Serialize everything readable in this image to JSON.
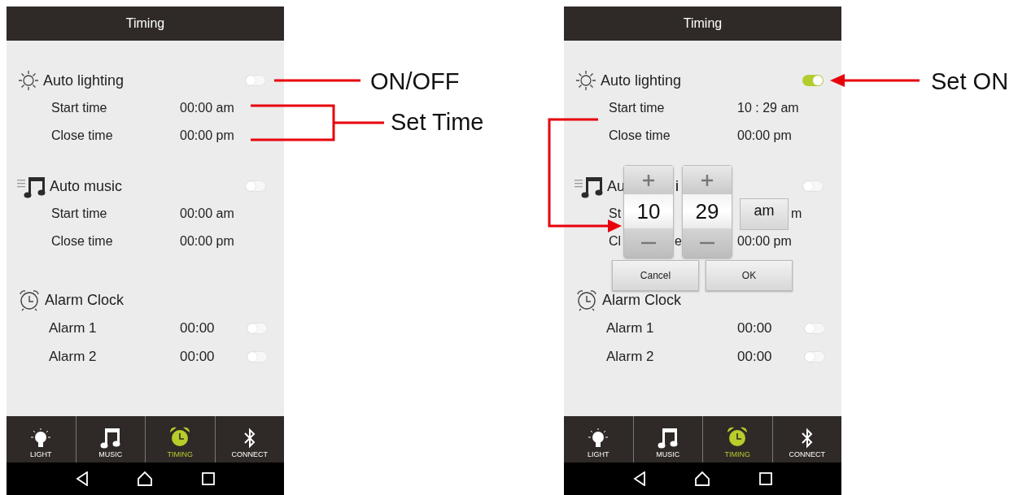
{
  "phones": [
    {
      "title": "Timing",
      "sections": [
        {
          "kind": "lighting",
          "title": "Auto lighting",
          "on": false,
          "rows": [
            {
              "kind": "time",
              "label": "Start time",
              "value": "00:00 am"
            },
            {
              "kind": "time",
              "label": "Close time",
              "value": "00:00 pm"
            }
          ]
        },
        {
          "kind": "music",
          "title": "Auto music",
          "on": false,
          "rows": [
            {
              "kind": "time",
              "label": "Start time",
              "value": "00:00 am"
            },
            {
              "kind": "time",
              "label": "Close time",
              "value": "00:00 pm"
            }
          ]
        },
        {
          "kind": "alarm",
          "title": "Alarm Clock",
          "rows": [
            {
              "kind": "alarm",
              "label": "Alarm 1",
              "value": "00:00",
              "on": false
            },
            {
              "kind": "alarm",
              "label": "Alarm 2",
              "value": "00:00",
              "on": false
            }
          ]
        }
      ],
      "tabs": [
        {
          "kind": "light",
          "label": "LIGHT",
          "selected": false
        },
        {
          "kind": "music",
          "label": "MUSIC",
          "selected": false
        },
        {
          "kind": "timing",
          "label": "TIMING",
          "selected": true
        },
        {
          "kind": "connect",
          "label": "CONNECT",
          "selected": false
        }
      ]
    },
    {
      "title": "Timing",
      "sections": [
        {
          "kind": "lighting",
          "title": "Auto lighting",
          "on": true,
          "rows": [
            {
              "kind": "time",
              "label": "Start time",
              "value": "10 : 29 am"
            },
            {
              "kind": "time",
              "label": "Close time",
              "value": "00:00 pm"
            }
          ]
        },
        {
          "kind": "music",
          "title": "Au",
          "title_tail": "i",
          "on": false,
          "rows": [
            {
              "kind": "time",
              "label": "St",
              "value_tail": "m"
            },
            {
              "kind": "time",
              "label": "Cl",
              "label_tail": "e",
              "value": "00:00 pm"
            }
          ]
        },
        {
          "kind": "alarm",
          "title": "Alarm Clock",
          "rows": [
            {
              "kind": "alarm",
              "label": "Alarm 1",
              "value": "00:00",
              "on": false
            },
            {
              "kind": "alarm",
              "label": "Alarm 2",
              "value": "00:00",
              "on": false
            }
          ]
        }
      ],
      "dialog": {
        "hours": "10",
        "minutes": "29",
        "period": "am",
        "buttons": [
          "Cancel",
          "OK"
        ]
      },
      "tabs": [
        {
          "kind": "light",
          "label": "LIGHT",
          "selected": false
        },
        {
          "kind": "music",
          "label": "MUSIC",
          "selected": false
        },
        {
          "kind": "timing",
          "label": "TIMING",
          "selected": true
        },
        {
          "kind": "connect",
          "label": "CONNECT",
          "selected": false
        }
      ]
    }
  ],
  "callouts": [
    {
      "kind": "onoff",
      "text": "ON/OFF"
    },
    {
      "kind": "settime",
      "text": "Set Time"
    },
    {
      "kind": "seton",
      "text": "Set ON"
    }
  ]
}
